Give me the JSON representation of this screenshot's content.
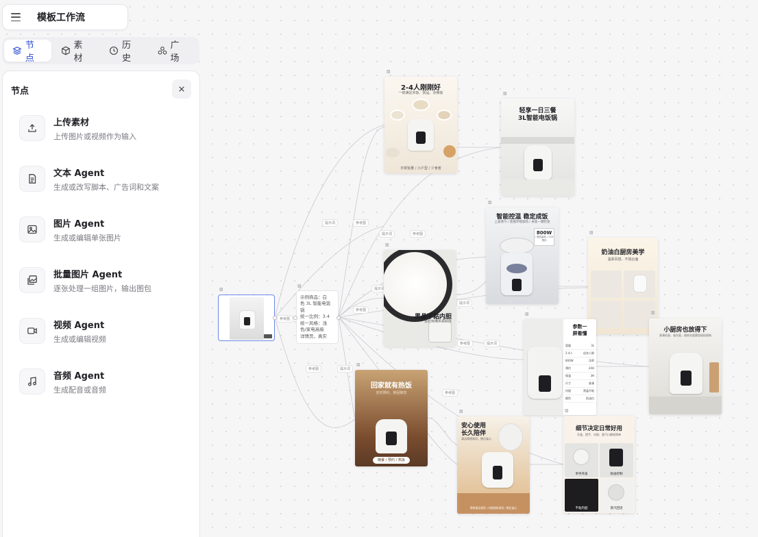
{
  "header": {
    "title": "模板工作流"
  },
  "tabs": [
    {
      "label": "节点",
      "icon": "layers-icon",
      "active": true
    },
    {
      "label": "素材",
      "icon": "cube-icon",
      "active": false
    },
    {
      "label": "历史",
      "icon": "clock-icon",
      "active": false
    },
    {
      "label": "广场",
      "icon": "community-icon",
      "active": false
    }
  ],
  "panel": {
    "title": "节点",
    "items": [
      {
        "name": "上传素材",
        "desc": "上传图片或视频作为输入",
        "icon": "upload-icon"
      },
      {
        "name": "文本 Agent",
        "desc": "生成或改写脚本、广告词和文案",
        "icon": "document-icon"
      },
      {
        "name": "图片 Agent",
        "desc": "生成或编辑单张图片",
        "icon": "image-icon"
      },
      {
        "name": "批量图片 Agent",
        "desc": "逐张处理一组图片，输出图包",
        "icon": "images-icon"
      },
      {
        "name": "视频 Agent",
        "desc": "生成或编辑视频",
        "icon": "video-icon"
      },
      {
        "name": "音频 Agent",
        "desc": "生成配音或音频",
        "icon": "music-icon"
      }
    ]
  },
  "canvas": {
    "text_node": {
      "lines": [
        "示例商品：白",
        "色 3L 智能电饭",
        "锅",
        "统一比例：3:4",
        "统一风格：浅",
        "色/家电高级",
        "详情页，真实"
      ]
    },
    "cards": {
      "c1": {
        "title": "2-4人刚刚好",
        "sub": "一锅满足米饭、粥品、杂粮饭",
        "foot": "日常饭量 / 小户型 / 少食者"
      },
      "c2": {
        "title1": "轻享一日三餐",
        "title2": "3L智能电饭锅"
      },
      "c3": {
        "title": "智能控温 稳定成饭",
        "sub": "上盖蒸汽 / 底盘环绕加热 / 米饭一键控温",
        "badge_value": "800W",
        "badge_sub": "/ 双层高效 / 24H预约"
      },
      "c4": {
        "title": "黑晶不粘内胆",
        "sub": "米粒饱满不易粘底"
      },
      "c5": {
        "title": "奶油白厨房美学",
        "sub": "温柔百搭，不挑台面"
      },
      "c6": {
        "title1": "参数一",
        "title2": "屏看懂"
      },
      "c7": {
        "title": "小厨房也放得下",
        "sub": "紧凑机身，省台面，厨房台面更加轻松收纳"
      },
      "c8": {
        "title": "回家就有热饭",
        "sub": "定时预约，随回随享",
        "foot": "晚餐 / 预约 / 热饭"
      },
      "c9": {
        "title1": "安心使用",
        "title2": "长久陪伴",
        "sub": "清洁简便易用，售后省心",
        "foot": "简单清洁易用 / 内胆易拆易洗 / 售后省心"
      },
      "c10": {
        "title": "细节决定日常好用",
        "sub": "开盖、提手、内胆、蒸汽口都很简单",
        "cells": [
          "单手开盖",
          "防溢控制",
          "不粘内胆",
          "蒸汽回流"
        ]
      }
    },
    "spec_rows": [
      [
        "容量",
        "3L"
      ],
      [
        "2-4人",
        "适合人群"
      ],
      [
        "800W",
        "功率"
      ],
      [
        "预约",
        "24H"
      ],
      [
        "保温",
        "3H"
      ],
      [
        "尺寸",
        "紧凑"
      ],
      [
        "内胆",
        "黑晶不粘"
      ],
      [
        "颜色",
        "奶油白"
      ]
    ],
    "chips": [
      "参考图",
      "提示词",
      "参考图",
      "提示词",
      "参考图",
      "提示词",
      "参考图",
      "提示词",
      "参考图",
      "提示词",
      "参考图",
      "提示词",
      "参考图"
    ]
  },
  "colors": {
    "accent": "#2b4bd0",
    "cooker_white": "#f4f4f2",
    "cream": "#f5ead8",
    "wood": "#c08a57",
    "upload_border": "#6a85e8"
  }
}
